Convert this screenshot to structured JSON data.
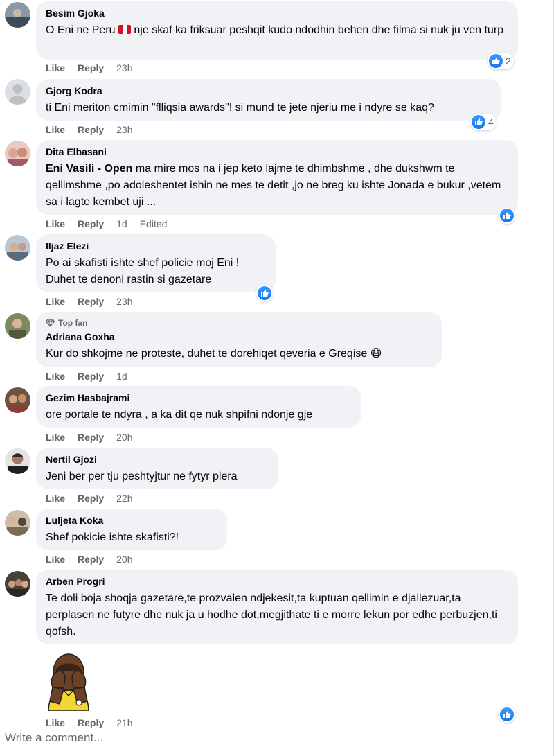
{
  "comments": [
    {
      "author": "Besim Gjoka",
      "text_before": "O Eni ne Peru ",
      "text_after": " nje skaf ka friksuar peshqit kudo ndodhin behen dhe filma si nuk ju ven turp",
      "like": "Like",
      "reply": "Reply",
      "time": "23h",
      "reactions": "2"
    },
    {
      "author": "Gjorg Kodra",
      "text": "ti Eni meriton cmimin \"flliqsia awards\"! si mund te jete njeriu me i ndyre se kaq?",
      "like": "Like",
      "reply": "Reply",
      "time": "23h",
      "reactions": "4"
    },
    {
      "author": "Dita Elbasani",
      "mention": "Eni Vasili - Open",
      "text": " ma mire mos na i jep keto lajme te dhimbshme , dhe dukshwm te qellimshme ,po adoleshentet ishin ne mes te detit ,jo ne breg ku ishte Jonada e bukur ,vetem sa i lagte kembet uji ...",
      "like": "Like",
      "reply": "Reply",
      "time": "1d",
      "edited": "Edited"
    },
    {
      "author": "Iljaz Elezi",
      "text": "Po ai skafisti ishte shef policie moj Eni ! Duhet te denoni rastin si gazetare",
      "like": "Like",
      "reply": "Reply",
      "time": "23h"
    },
    {
      "badge": "Top fan",
      "author": "Adriana Goxha",
      "text": "Kur do shkojme ne proteste, duhet te dorehiqet qeveria e Greqise 😷",
      "like": "Like",
      "reply": "Reply",
      "time": "1d"
    },
    {
      "author": "Gezim Hasbajrami",
      "text": "ore portale te ndyra , a ka dit qe nuk shpifni ndonje gje",
      "like": "Like",
      "reply": "Reply",
      "time": "20h"
    },
    {
      "author": "Nertil Gjozi",
      "text": "Jeni ber per tju peshtyjtur ne fytyr plera",
      "like": "Like",
      "reply": "Reply",
      "time": "22h"
    },
    {
      "author": "Luljeta Koka",
      "text": "Shef pokicie ishte skafisti?!",
      "like": "Like",
      "reply": "Reply",
      "time": "20h"
    },
    {
      "author": "Arben Progri",
      "text": "Te doli boja shoqja gazetare,te prozvalen ndjekesit,ta kuptuan qellimin e djallezuar,ta perplasen ne futyre dhe nuk ja u hodhe dot,megjithate ti e morre lekun por edhe perbuzjen,ti qofsh.",
      "like": "Like",
      "reply": "Reply",
      "time": "21h"
    }
  ],
  "composer": {
    "placeholder": "Write a comment..."
  },
  "icons": {
    "like": "thumbs-up-icon",
    "topfan": "diamond-icon",
    "flag": "peru-flag-icon",
    "sticker": "face-palm-sticker"
  },
  "colors": {
    "like_blue": "#1877f2",
    "bubble": "#f0f2f5",
    "meta": "#65676b"
  }
}
